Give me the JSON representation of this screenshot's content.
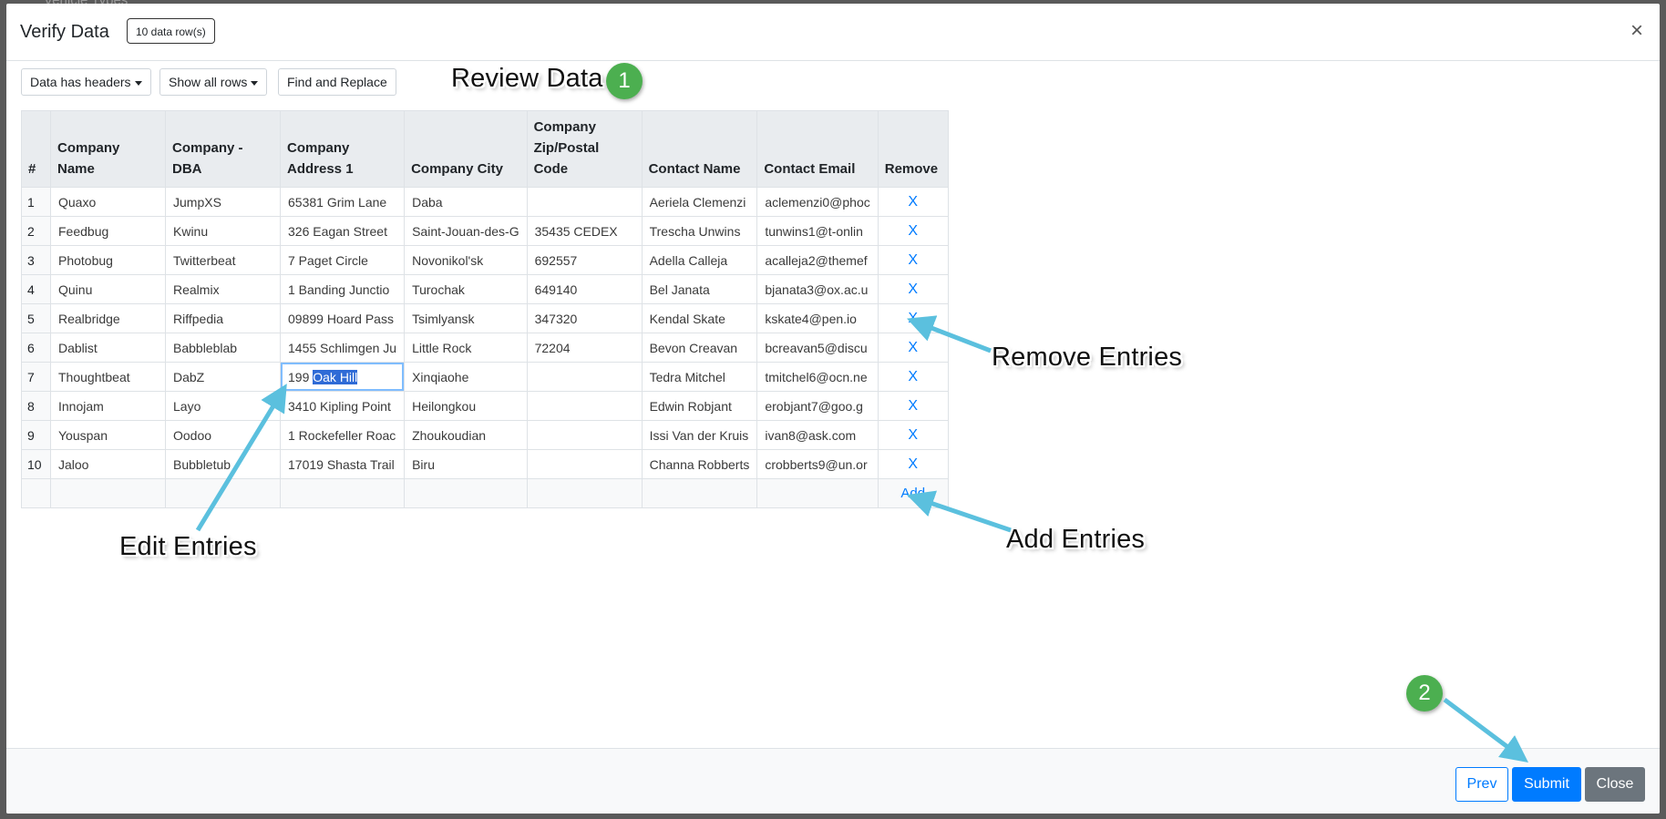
{
  "backdrop": {
    "text": "Vehicle Types"
  },
  "modal": {
    "title": "Verify Data",
    "rows_badge": "10 data row(s)",
    "close_symbol": "×"
  },
  "toolbar": {
    "headers_label": "Data has headers",
    "show_rows_label": "Show all rows",
    "find_replace_label": "Find and Replace"
  },
  "callouts": {
    "review": "Review Data",
    "review_step": "1",
    "remove": "Remove Entries",
    "add": "Add Entries",
    "edit": "Edit Entries",
    "submit_step": "2"
  },
  "table": {
    "headers": [
      "#",
      "Company Name",
      "Company - DBA",
      "Company Address 1",
      "Company City",
      "Company Zip/Postal Code",
      "Contact Name",
      "Contact Email",
      "Remove"
    ],
    "rows": [
      [
        "1",
        "Quaxo",
        "JumpXS",
        "65381 Grim Lane",
        "Daba",
        "",
        "Aeriela Clemenzi",
        "aclemenzi0@phoc"
      ],
      [
        "2",
        "Feedbug",
        "Kwinu",
        "326 Eagan Street",
        "Saint-Jouan-des-G",
        "35435 CEDEX",
        "Trescha Unwins",
        "tunwins1@t-onlin"
      ],
      [
        "3",
        "Photobug",
        "Twitterbeat",
        "7 Paget Circle",
        "Novonikol'sk",
        "692557",
        "Adella Calleja",
        "acalleja2@themef"
      ],
      [
        "4",
        "Quinu",
        "Realmix",
        "1 Banding Junctio",
        "Turochak",
        "649140",
        "Bel Janata",
        "bjanata3@ox.ac.u"
      ],
      [
        "5",
        "Realbridge",
        "Riffpedia",
        "09899 Hoard Pass",
        "Tsimlyansk",
        "347320",
        "Kendal Skate",
        "kskate4@pen.io"
      ],
      [
        "6",
        "Dablist",
        "Babbleblab",
        "1455 Schlimgen Ju",
        "Little Rock",
        "72204",
        "Bevon Creavan",
        "bcreavan5@discu"
      ],
      [
        "7",
        "Thoughtbeat",
        "DabZ",
        "199 Oak Hill",
        "Xinqiaohe",
        "",
        "Tedra Mitchel",
        "tmitchel6@ocn.ne"
      ],
      [
        "8",
        "Innojam",
        "Layo",
        "3410 Kipling Point",
        "Heilongkou",
        "",
        "Edwin Robjant",
        "erobjant7@goo.g"
      ],
      [
        "9",
        "Youspan",
        "Oodoo",
        "1 Rockefeller Roac",
        "Zhoukoudian",
        "",
        "Issi Van der Kruis",
        "ivan8@ask.com"
      ],
      [
        "10",
        "Jaloo",
        "Bubbletub",
        "17019 Shasta Trail",
        "Biru",
        "",
        "Channa Robberts",
        "crobberts9@un.or"
      ]
    ],
    "remove_label": "X",
    "add_label": "Add",
    "editing_prefix": "199 ",
    "editing_selected": "Oak Hill"
  },
  "footer": {
    "prev_label": "Prev",
    "submit_label": "Submit",
    "close_label": "Close"
  },
  "colors": {
    "primary": "#007bff",
    "secondary": "#6c757d",
    "callout_badge": "#4caf50",
    "arrow": "#5bc0de"
  }
}
